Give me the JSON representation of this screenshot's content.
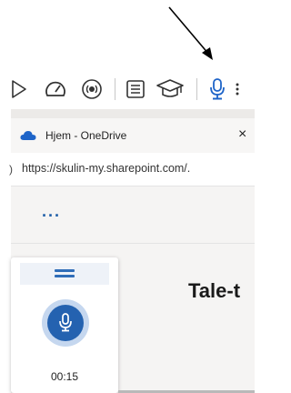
{
  "toolbar": {
    "buttons": [
      "play-icon",
      "speed-icon",
      "voice-settings-icon",
      "text-list-icon",
      "graduation-cap-icon",
      "microphone-icon"
    ]
  },
  "browser": {
    "tab": {
      "title": "Hjem - OneDrive",
      "close_label": "×"
    },
    "address": {
      "fragment": ")",
      "url": "https://skulin-my.sharepoint.com/."
    }
  },
  "page": {
    "more_label": "···",
    "dictation": {
      "timer": "00:15"
    },
    "document_title": "Tale-t"
  },
  "colors": {
    "accent": "#2462b0",
    "mic_ring": "#c5d7ef",
    "onedrive": "#1e64c8"
  }
}
